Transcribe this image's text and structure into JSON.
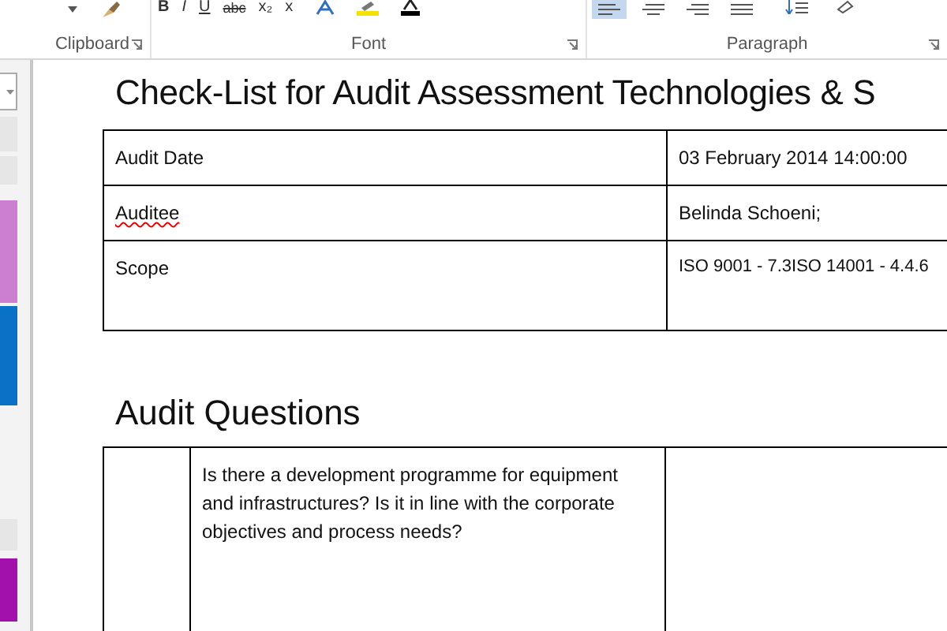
{
  "ribbon": {
    "groups": [
      {
        "label": "Clipboard"
      },
      {
        "label": "Font"
      },
      {
        "label": "Paragraph"
      }
    ],
    "font_buttons": [
      "B",
      "I",
      "U",
      "abc",
      "x₂",
      "x"
    ],
    "paragraph_buttons": [
      {
        "kind": "align-left",
        "selected": true
      },
      {
        "kind": "align-center",
        "selected": false
      },
      {
        "kind": "align-right",
        "selected": false
      },
      {
        "kind": "justify",
        "selected": false
      }
    ]
  },
  "side_tiles": [
    {
      "kind": "field"
    },
    {
      "kind": "tile",
      "color": "#e6e6e6"
    },
    {
      "kind": "tile",
      "color": "#e6e6e6"
    },
    {
      "kind": "tile",
      "color": "#cc7ed0"
    },
    {
      "kind": "tile",
      "color": "#0a72c6"
    },
    {
      "kind": "tile",
      "color": "#e6e6e6"
    },
    {
      "kind": "tile",
      "color": "#a211ac"
    }
  ],
  "document": {
    "title": "Check-List for Audit Assessment Technologies & S",
    "info_rows": [
      {
        "label": "Audit Date",
        "misspelled": false,
        "value": "03 February 2014 14:00:00"
      },
      {
        "label": "Auditee",
        "misspelled": true,
        "value": "Belinda Schoeni;"
      },
      {
        "label": "Scope",
        "misspelled": false,
        "value": "ISO 9001 - 7.3ISO 14001 - 4.4.6"
      }
    ],
    "section_heading": "Audit Questions",
    "questions": [
      {
        "text": "Is there a development programme for equipment and infrastructures? Is it in line with the corporate objectives and process needs?"
      }
    ]
  }
}
